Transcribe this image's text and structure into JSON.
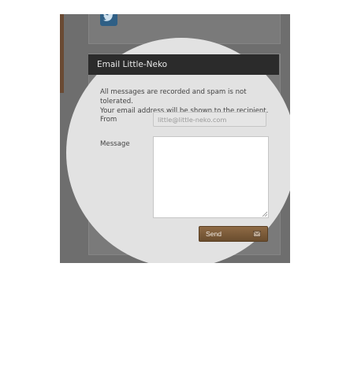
{
  "form": {
    "title": "Email Little-Neko",
    "info_line1": "All messages are recorded and spam is not tolerated.",
    "info_line2": "Your email address will be shown to the recipient.",
    "from_label": "From",
    "from_placeholder": "little@little-neko.com",
    "from_value": "",
    "message_label": "Message",
    "message_value": "",
    "send_label": "Send"
  },
  "icons": {
    "social": "twitter-icon",
    "send": "envelope-icon"
  },
  "colors": {
    "header_bg": "#2b2b2b",
    "send_button": "#7a5a38",
    "twitter": "#2f5f85"
  }
}
